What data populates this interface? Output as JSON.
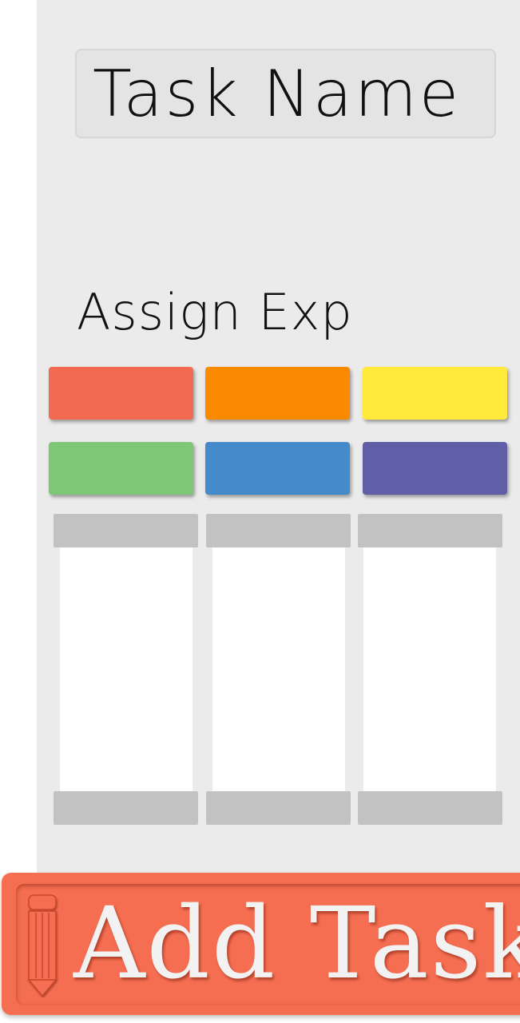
{
  "task_name": {
    "placeholder": "Task Name",
    "value": ""
  },
  "assign": {
    "label": "Assign Exp",
    "colors": [
      {
        "name": "red",
        "hex": "#f26a51"
      },
      {
        "name": "orange",
        "hex": "#fb8a00"
      },
      {
        "name": "yellow",
        "hex": "#ffea3b"
      },
      {
        "name": "green",
        "hex": "#7ec776"
      },
      {
        "name": "blue",
        "hex": "#458bcc"
      },
      {
        "name": "purple",
        "hex": "#615ea8"
      }
    ]
  },
  "add_task": {
    "label": "Add Task",
    "icon": "pencil-icon",
    "color": "#f56e52"
  }
}
